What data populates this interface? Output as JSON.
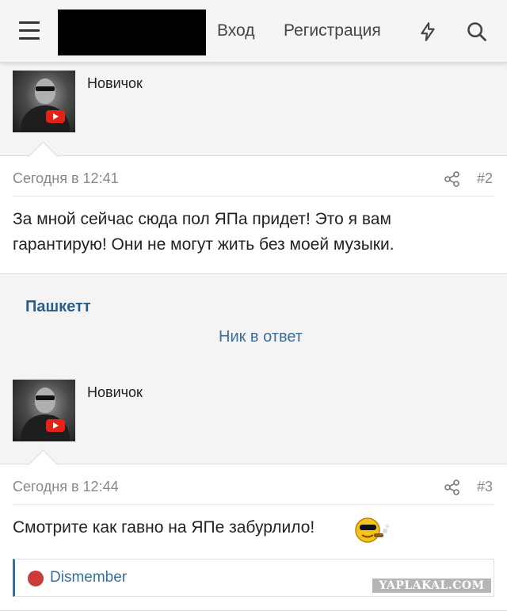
{
  "header": {
    "login_label": "Вход",
    "register_label": "Регистрация"
  },
  "posts": [
    {
      "user_rank": "Новичок",
      "time": "Сегодня в 12:41",
      "number": "#2",
      "text": "За мной сейчас сюда пол ЯПа придет! Это я вам гарантирую! Они не могут жить без моей музыки."
    },
    {
      "author": "Пашкетт",
      "reply_label": "Ник в ответ",
      "user_rank": "Новичок",
      "time": "Сегодня в 12:44",
      "number": "#3",
      "text": "Смотрите как гавно на ЯПе забурлило!",
      "reactions": [
        {
          "type": "dislike-icon",
          "user": "Dismember"
        }
      ]
    }
  ],
  "watermark": "YAPLAKAL.COM",
  "colors": {
    "link": "#3a6f9a",
    "author": "#2b5d86",
    "dislike": "#cc3b3b",
    "youtube": "#e62117"
  }
}
